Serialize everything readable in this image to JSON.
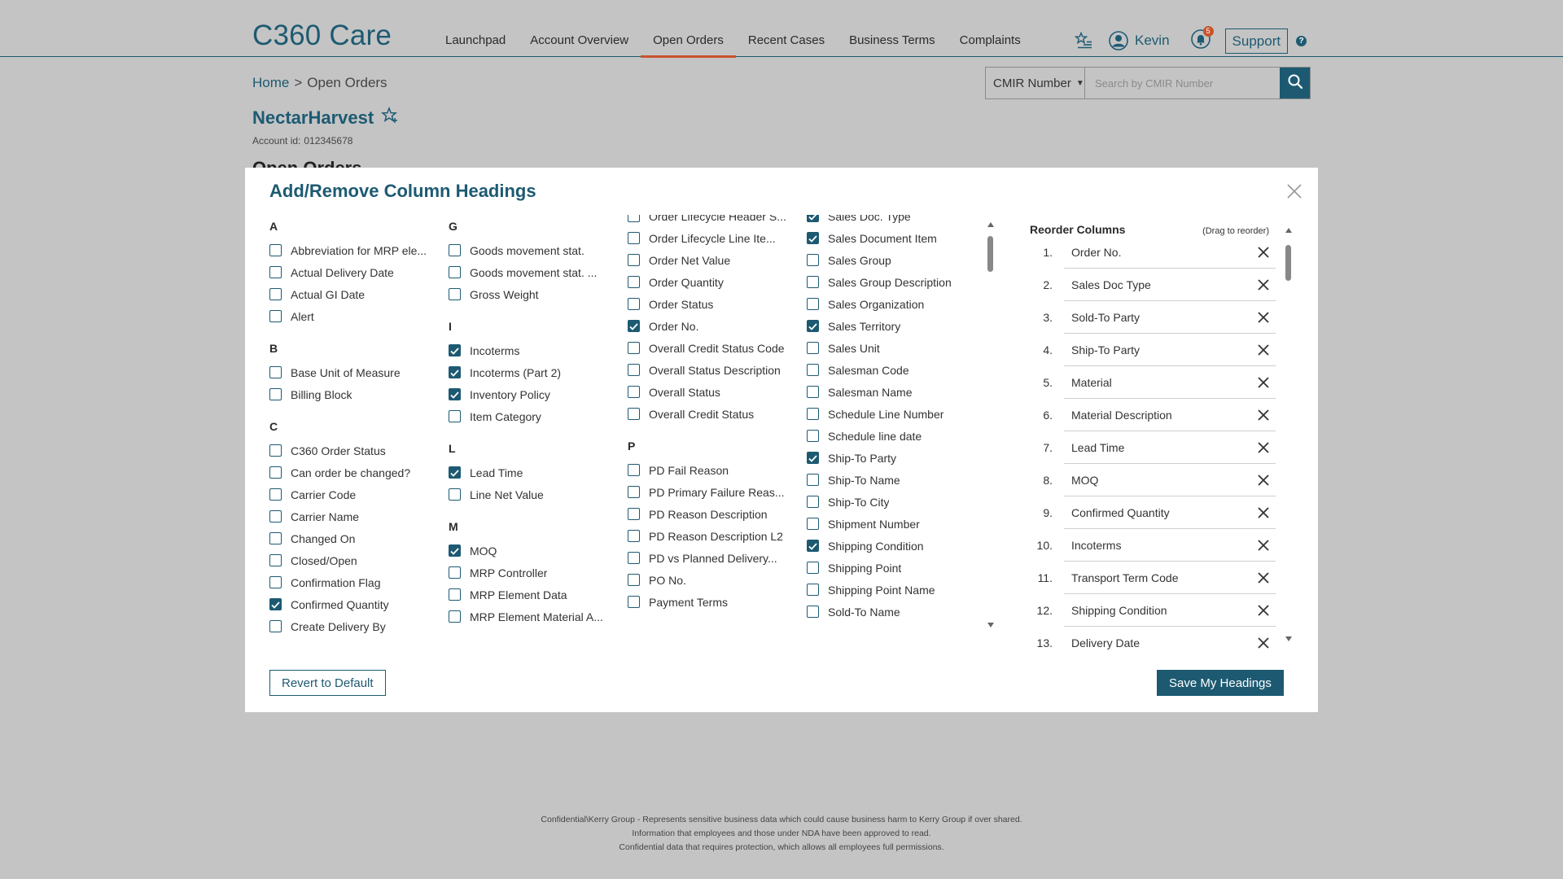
{
  "app": {
    "title": "C360 Care"
  },
  "nav": [
    {
      "label": "Launchpad",
      "active": false
    },
    {
      "label": "Account Overview",
      "active": false
    },
    {
      "label": "Open Orders",
      "active": true
    },
    {
      "label": "Recent Cases",
      "active": false
    },
    {
      "label": "Business Terms",
      "active": false
    },
    {
      "label": "Complaints",
      "active": false
    }
  ],
  "header": {
    "user_name": "Kevin",
    "notification_count": "5",
    "support_label": "Support",
    "help_glyph": "?"
  },
  "breadcrumb": {
    "home": "Home",
    "separator": ">",
    "current": "Open Orders"
  },
  "search": {
    "type_label": "CMIR Number",
    "placeholder": "Search by CMIR Number"
  },
  "account": {
    "name": "NectarHarvest",
    "id_label": "Account id:",
    "id_value": "012345678"
  },
  "section_title": "Open Orders",
  "modal": {
    "title": "Add/Remove Column Headings",
    "revert_label": "Revert to Default",
    "save_label": "Save My Headings",
    "columns": [
      [
        {
          "letter": "A",
          "items": [
            {
              "label": "Abbreviation for MRP ele...",
              "checked": false
            },
            {
              "label": "Actual Delivery Date",
              "checked": false
            },
            {
              "label": "Actual GI Date",
              "checked": false
            },
            {
              "label": "Alert",
              "checked": false
            }
          ]
        },
        {
          "letter": "B",
          "items": [
            {
              "label": "Base Unit of Measure",
              "checked": false
            },
            {
              "label": "Billing Block",
              "checked": false
            }
          ]
        },
        {
          "letter": "C",
          "items": [
            {
              "label": "C360 Order Status",
              "checked": false
            },
            {
              "label": "Can order be changed?",
              "checked": false
            },
            {
              "label": "Carrier Code",
              "checked": false
            },
            {
              "label": "Carrier Name",
              "checked": false
            },
            {
              "label": "Changed On",
              "checked": false
            },
            {
              "label": "Closed/Open",
              "checked": false
            },
            {
              "label": "Confirmation Flag",
              "checked": false
            },
            {
              "label": "Confirmed Quantity",
              "checked": true
            },
            {
              "label": "Create Delivery By",
              "checked": false
            }
          ]
        }
      ],
      [
        {
          "letter": "G",
          "items": [
            {
              "label": "Goods movement stat.",
              "checked": false
            },
            {
              "label": "Goods movement stat. ...",
              "checked": false
            },
            {
              "label": "Gross Weight",
              "checked": false
            }
          ]
        },
        {
          "letter": "I",
          "items": [
            {
              "label": "Incoterms",
              "checked": true
            },
            {
              "label": "Incoterms (Part 2)",
              "checked": true
            },
            {
              "label": "Inventory Policy",
              "checked": true
            },
            {
              "label": "Item Category",
              "checked": false
            }
          ]
        },
        {
          "letter": "L",
          "items": [
            {
              "label": "Lead Time",
              "checked": true
            },
            {
              "label": "Line Net Value",
              "checked": false
            }
          ]
        },
        {
          "letter": "M",
          "items": [
            {
              "label": "MOQ",
              "checked": true
            },
            {
              "label": "MRP Controller",
              "checked": false
            },
            {
              "label": "MRP Element Data",
              "checked": false
            },
            {
              "label": "MRP Element Material A...",
              "checked": false
            }
          ]
        }
      ],
      [
        {
          "letter": "",
          "items": [
            {
              "label": "Order Lifecycle Header S...",
              "checked": false
            },
            {
              "label": "Order Lifecycle Line Ite...",
              "checked": false
            },
            {
              "label": "Order Net Value",
              "checked": false
            },
            {
              "label": "Order Quantity",
              "checked": false
            },
            {
              "label": "Order Status",
              "checked": false
            },
            {
              "label": "Order No.",
              "checked": true
            },
            {
              "label": "Overall Credit Status Code",
              "checked": false
            },
            {
              "label": "Overall Status Description",
              "checked": false
            },
            {
              "label": "Overall Status",
              "checked": false
            },
            {
              "label": "Overall Credit Status",
              "checked": false
            }
          ]
        },
        {
          "letter": "P",
          "items": [
            {
              "label": "PD Fail Reason",
              "checked": false
            },
            {
              "label": "PD Primary Failure Reas...",
              "checked": false
            },
            {
              "label": "PD Reason Description",
              "checked": false
            },
            {
              "label": "PD Reason Description L2",
              "checked": false
            },
            {
              "label": "PD vs Planned Delivery...",
              "checked": false
            },
            {
              "label": "PO No.",
              "checked": false
            },
            {
              "label": "Payment Terms",
              "checked": false
            }
          ]
        }
      ],
      [
        {
          "letter": "",
          "items": [
            {
              "label": "Sales Doc. Type",
              "checked": true
            },
            {
              "label": "Sales Document Item",
              "checked": true
            },
            {
              "label": "Sales Group",
              "checked": false
            },
            {
              "label": "Sales Group Description",
              "checked": false
            },
            {
              "label": "Sales Organization",
              "checked": false
            },
            {
              "label": "Sales Territory",
              "checked": true
            },
            {
              "label": "Sales Unit",
              "checked": false
            },
            {
              "label": "Salesman Code",
              "checked": false
            },
            {
              "label": "Salesman Name",
              "checked": false
            },
            {
              "label": "Schedule Line Number",
              "checked": false
            },
            {
              "label": "Schedule line date",
              "checked": false
            },
            {
              "label": "Ship-To Party",
              "checked": true
            },
            {
              "label": "Ship-To Name",
              "checked": false
            },
            {
              "label": "Ship-To City",
              "checked": false
            },
            {
              "label": "Shipment Number",
              "checked": false
            },
            {
              "label": "Shipping Condition",
              "checked": true
            },
            {
              "label": "Shipping Point",
              "checked": false
            },
            {
              "label": "Shipping Point Name",
              "checked": false
            },
            {
              "label": "Sold-To Name",
              "checked": false
            }
          ]
        }
      ]
    ],
    "reorder": {
      "title": "Reorder Columns",
      "hint": "(Drag to reorder)",
      "items": [
        {
          "num": "1.",
          "label": "Order No."
        },
        {
          "num": "2.",
          "label": "Sales Doc Type"
        },
        {
          "num": "3.",
          "label": "Sold-To Party"
        },
        {
          "num": "4.",
          "label": "Ship-To Party"
        },
        {
          "num": "5.",
          "label": "Material"
        },
        {
          "num": "6.",
          "label": "Material Description"
        },
        {
          "num": "7.",
          "label": "Lead Time"
        },
        {
          "num": "8.",
          "label": "MOQ"
        },
        {
          "num": "9.",
          "label": "Confirmed Quantity"
        },
        {
          "num": "10.",
          "label": "Incoterms"
        },
        {
          "num": "11.",
          "label": "Transport Term Code"
        },
        {
          "num": "12.",
          "label": "Shipping Condition"
        },
        {
          "num": "13.",
          "label": "Delivery Date"
        }
      ]
    }
  },
  "footer": {
    "line1": "Confidential\\Kerry Group - Represents sensitive business data which could cause business harm to Kerry Group if over shared.",
    "line2": "Information that employees and those under NDA have been approved to read.",
    "line3": "Confidential data that requires protection, which allows all employees full permissions."
  },
  "colors": {
    "primary": "#1d5a72",
    "accent": "#c9532c",
    "overlay": "#c4c4c4"
  },
  "icons": [
    "favorites-list-icon",
    "user-icon",
    "bell-icon",
    "help-icon",
    "search-icon",
    "star-icon",
    "close-icon",
    "check-icon",
    "remove-icon",
    "scroll-up-icon",
    "scroll-down-icon"
  ]
}
